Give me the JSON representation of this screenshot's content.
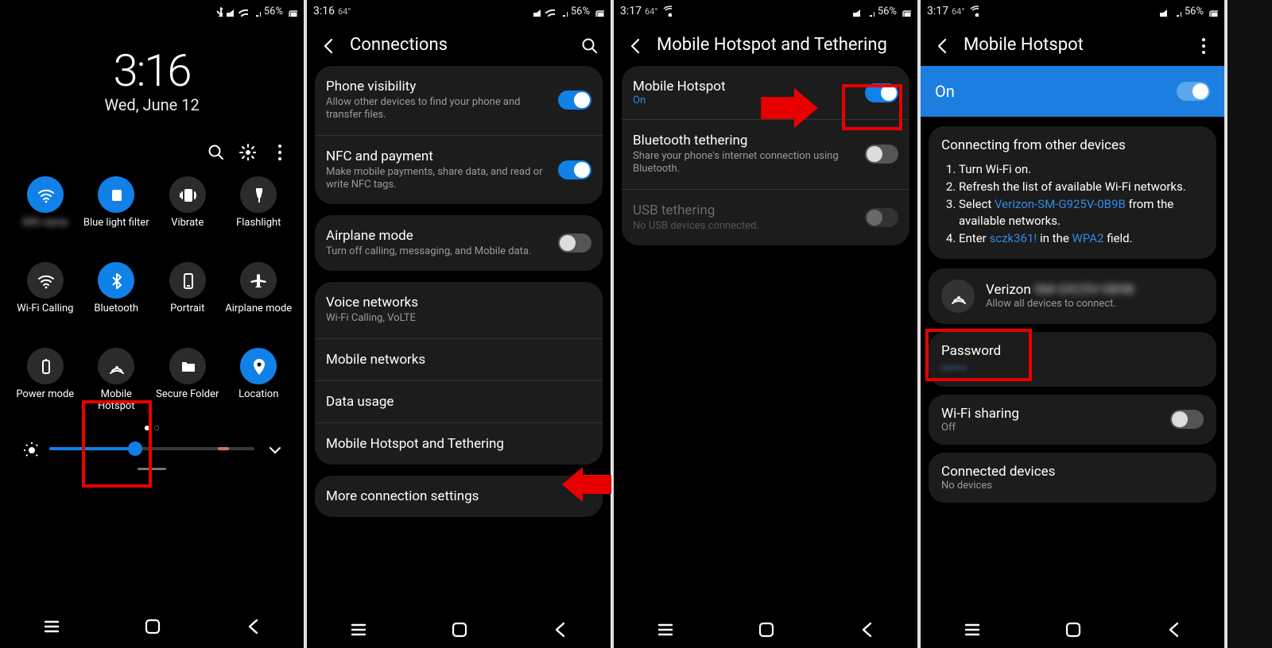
{
  "s1": {
    "statusbar": {
      "battery": "56%"
    },
    "clock": "3:16",
    "date": "Wed, June 12",
    "tiles": {
      "wifi": "",
      "bluelight": "Blue light filter",
      "vibrate": "Vibrate",
      "flashlight": "Flashlight",
      "wificall": "Wi-Fi Calling",
      "bluetooth": "Bluetooth",
      "portrait": "Portrait",
      "airplane": "Airplane mode",
      "power": "Power mode",
      "hotspot": "Mobile Hotspot",
      "secure": "Secure Folder",
      "location": "Location"
    }
  },
  "s2": {
    "statusbar": {
      "time": "3:16",
      "temp": "64°",
      "battery": "56%"
    },
    "title": "Connections",
    "rows": {
      "phonevis": {
        "name": "Phone visibility",
        "desc": "Allow other devices to find your phone and transfer files."
      },
      "nfc": {
        "name": "NFC and payment",
        "desc": "Make mobile payments, share data, and read or write NFC tags."
      },
      "airplane": {
        "name": "Airplane mode",
        "desc": "Turn off calling, messaging, and Mobile data."
      },
      "voice": {
        "name": "Voice networks",
        "desc": "Wi-Fi Calling, VoLTE"
      },
      "mobilenet": {
        "name": "Mobile networks"
      },
      "datausage": {
        "name": "Data usage"
      },
      "tether": {
        "name": "Mobile Hotspot and Tethering"
      },
      "more": {
        "name": "More connection settings"
      }
    }
  },
  "s3": {
    "statusbar": {
      "time": "3:17",
      "temp": "64°",
      "battery": "56%"
    },
    "title": "Mobile Hotspot and Tethering",
    "rows": {
      "hotspot": {
        "name": "Mobile Hotspot",
        "status": "On"
      },
      "bttether": {
        "name": "Bluetooth tethering",
        "desc": "Share your phone's internet connection using Bluetooth."
      },
      "usbtether": {
        "name": "USB tethering",
        "desc": "No USB devices connected."
      }
    }
  },
  "s4": {
    "statusbar": {
      "time": "3:17",
      "temp": "64°",
      "battery": "56%"
    },
    "title": "Mobile Hotspot",
    "banner": "On",
    "instr": {
      "heading": "Connecting from other devices",
      "i1": "Turn Wi-Fi on.",
      "i2": "Refresh the list of available Wi-Fi networks.",
      "i3a": "Select ",
      "i3link": "Verizon-SM-G925V-0B9B",
      "i3b": " from the available networks.",
      "i4a": "Enter ",
      "i4pw": "sczk361!",
      "i4b": " in the ",
      "i4link": "WPA2",
      "i4c": " field."
    },
    "ssid": {
      "name": "Verizon",
      "desc": "Allow all devices to connect."
    },
    "password": {
      "name": "Password",
      "value": "••••••"
    },
    "wifishare": {
      "name": "Wi-Fi sharing",
      "status": "Off"
    },
    "conn": {
      "name": "Connected devices",
      "desc": "No devices"
    }
  }
}
